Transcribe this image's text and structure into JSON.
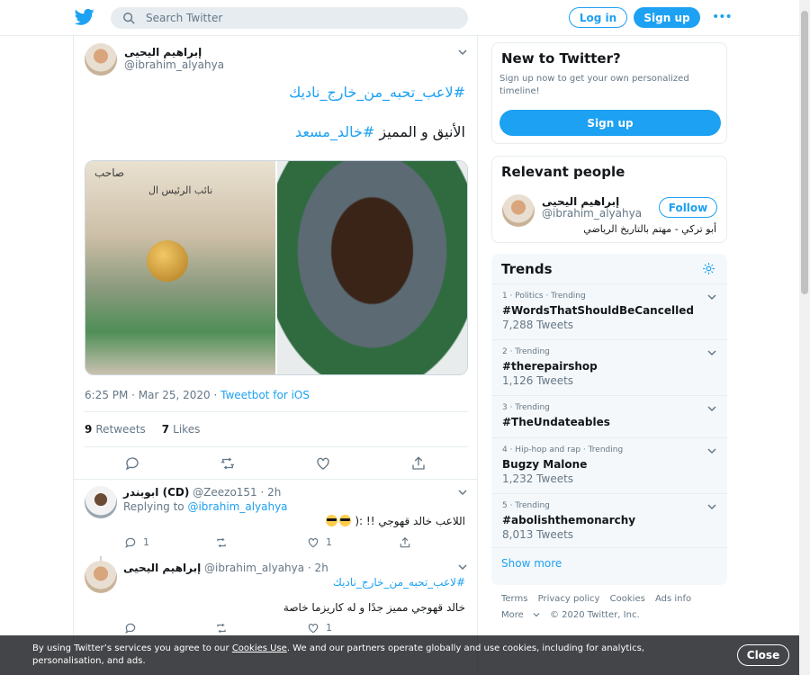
{
  "header": {
    "search_placeholder": "Search Twitter",
    "login_label": "Log in",
    "signup_label": "Sign up",
    "more_label": "•••"
  },
  "tweet": {
    "author_name": "إبراهيم اليحيى",
    "author_handle": "@ibrahim_alyahya",
    "line1_hashtag": "#لاعب_تحبه_من_خارج_ناديك",
    "line2_text": "الأنيق و المميز",
    "line2_hashtag": "#خالد_مسعد",
    "photo1_sign": "صاحب",
    "photo1_sign2": "نائب الرئيس ال",
    "time": "6:25 PM · Mar 25, 2020 · ",
    "source": "Tweetbot for iOS",
    "retweets_count": "9",
    "retweets_label": "Retweets",
    "likes_count": "7",
    "likes_label": "Likes"
  },
  "replies": [
    {
      "name": "(CD) ابوبندر",
      "handle": "@Zeezo151 · 2h",
      "replying_prefix": "Replying to ",
      "replying_to": "@ibrahim_alyahya",
      "text": "اللاعب خالد قهوجي !! :(",
      "reply_count": "1",
      "like_count": "1"
    },
    {
      "name": "إبراهيم اليحيى",
      "handle": "@ibrahim_alyahya · 2h",
      "hashtag": "#لاعب_تحبه_من_خارج_ناديك",
      "text": "خالد قهوجي مميز جدًا و له كاريزما خاصة",
      "like_count": "1"
    }
  ],
  "new_to_twitter": {
    "title": "New to Twitter?",
    "subtitle": "Sign up now to get your own personalized timeline!",
    "button": "Sign up"
  },
  "relevant_people": {
    "title": "Relevant people",
    "name": "إبراهيم اليحيى",
    "handle": "@ibrahim_alyahya",
    "bio": "أبو تركي - مهتم بالتاريخ الرياضي",
    "follow_label": "Follow"
  },
  "trends": {
    "title": "Trends",
    "items": [
      {
        "context": "1 · Politics · Trending",
        "name": "#WordsThatShouldBeCancelled",
        "count": "7,288 Tweets"
      },
      {
        "context": "2 · Trending",
        "name": "#therepairshop",
        "count": "1,126 Tweets"
      },
      {
        "context": "3 · Trending",
        "name": "#TheUndateables",
        "count": ""
      },
      {
        "context": "4 · Hip-hop and rap · Trending",
        "name": "Bugzy Malone",
        "count": "1,232 Tweets"
      },
      {
        "context": "5 · Trending",
        "name": "#abolishthemonarchy",
        "count": "8,013 Tweets"
      }
    ],
    "show_more": "Show more"
  },
  "footer": {
    "links": [
      "Terms",
      "Privacy policy",
      "Cookies",
      "Ads info"
    ],
    "more": "More",
    "copyright": "© 2020 Twitter, Inc."
  },
  "cookie_banner": {
    "text_before": "By using Twitter’s services you agree to our ",
    "link": "Cookies Use",
    "text_after": ". We and our partners operate globally and use cookies, including for analytics, personalisation, and ads.",
    "close_label": "Close"
  },
  "colors": {
    "accent": "#1da1f2",
    "text": "#14171a",
    "muted": "#657786",
    "border": "#e6ecf0"
  }
}
